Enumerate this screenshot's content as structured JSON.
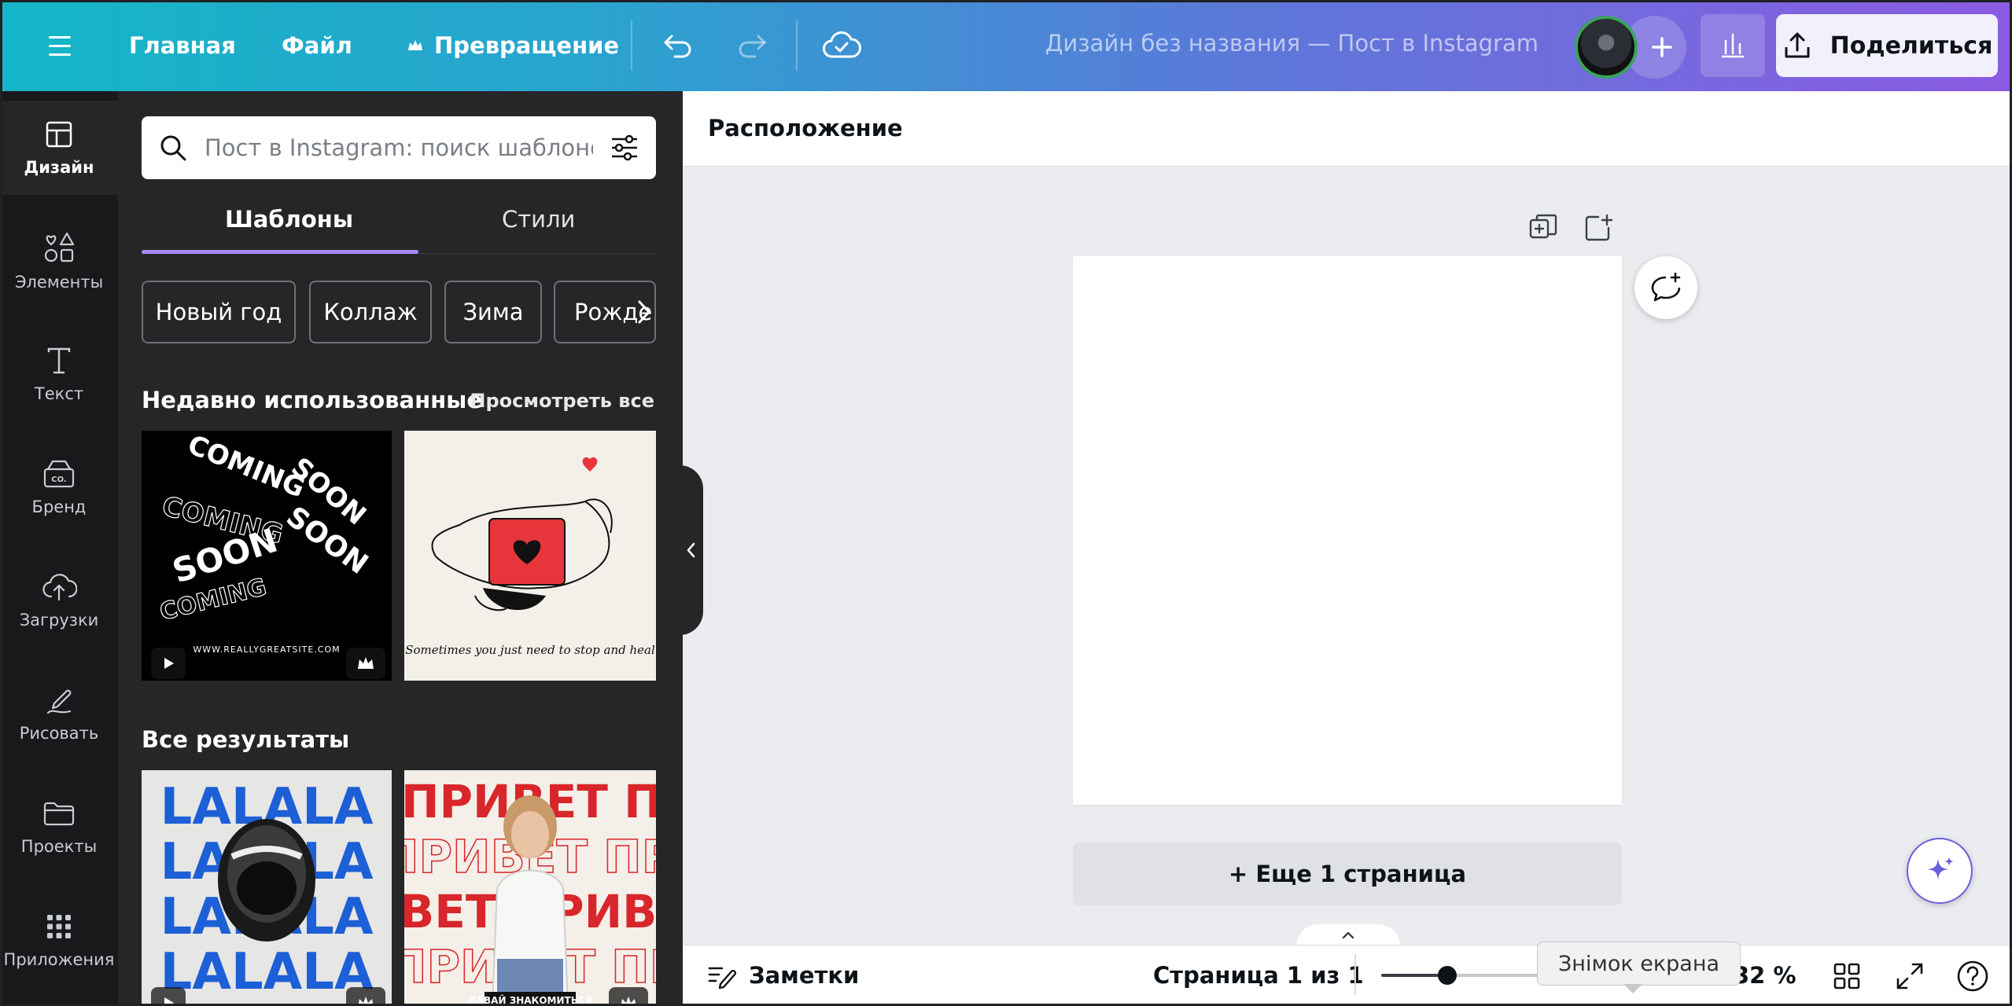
{
  "topbar": {
    "home": "Главная",
    "file": "Файл",
    "transform": "Превращение",
    "doc_title": "Дизайн без названия — Пост в Instagram",
    "share": "Поделиться"
  },
  "rail": {
    "items": [
      {
        "label": "Дизайн",
        "icon": "layout-icon"
      },
      {
        "label": "Элементы",
        "icon": "shapes-icon"
      },
      {
        "label": "Текст",
        "icon": "text-icon"
      },
      {
        "label": "Бренд",
        "icon": "brand-icon"
      },
      {
        "label": "Загрузки",
        "icon": "upload-cloud-icon"
      },
      {
        "label": "Рисовать",
        "icon": "draw-icon"
      },
      {
        "label": "Проекты",
        "icon": "folder-icon"
      },
      {
        "label": "Приложения",
        "icon": "apps-grid-icon"
      }
    ]
  },
  "panel": {
    "search_placeholder": "Пост в Instagram: поиск шаблонов",
    "tabs": [
      "Шаблоны",
      "Стили"
    ],
    "chips": [
      "Новый год",
      "Коллаж",
      "Зима",
      "Рожде"
    ],
    "recent_title": "Недавно использованные",
    "see_all": "Просмотреть все",
    "all_results_title": "Все результаты",
    "templates": {
      "coming_soon": {
        "words": [
          "COMING",
          "SOON",
          "COMING",
          "SOON",
          "COMING",
          "SOON"
        ],
        "site": "WWW.REALLYGREATSITE.COM"
      },
      "heal": {
        "caption": "Sometimes you just need to stop and heal"
      },
      "lalala": {
        "text": "LALALA"
      },
      "privet": {
        "text": "ПРИВЕТ ПРИВЕТ",
        "row2": "ПРИВЕТ ПРИ",
        "row3": "ВЕТ ПРИВЕТ",
        "row4": "ПРИВЕТ ПР",
        "badge": "ДАВАЙ ЗНАКОМИТЬСЯ"
      }
    }
  },
  "canvas": {
    "toolbar_label": "Расположение",
    "add_page": "+ Еще 1 страница"
  },
  "bottombar": {
    "notes": "Заметки",
    "page_indicator": "Страница 1 из 1",
    "zoom": "32 %",
    "zoom_fraction": 0.38
  },
  "tooltip": "Знімок екрана",
  "colors": {
    "accent_purple": "#a58cf5",
    "lalala_blue": "#1d5fd6",
    "privet_red": "#d9262b",
    "heart_red": "#e8353b"
  }
}
